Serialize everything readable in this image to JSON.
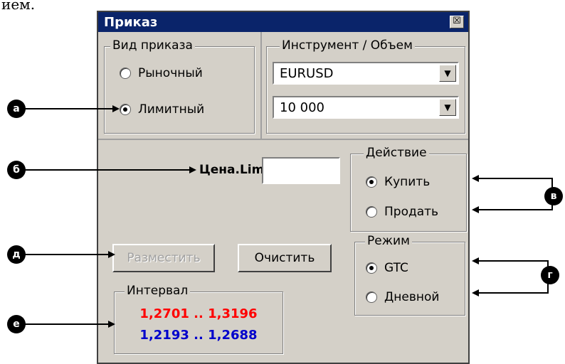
{
  "top_fragment": "ием.",
  "window": {
    "title": "Приказ",
    "close_glyph": "☒"
  },
  "order_type": {
    "legend": "Вид приказа",
    "options": [
      {
        "label": "Рыночный",
        "checked": false
      },
      {
        "label": "Лимитный",
        "checked": true
      }
    ]
  },
  "instrument": {
    "legend": "Инструмент / Объем",
    "symbol": "EURUSD",
    "volume": "10 000"
  },
  "price": {
    "label": "Цена.Lim",
    "value": ""
  },
  "action": {
    "legend": "Действие",
    "options": [
      {
        "label": "Купить",
        "checked": true
      },
      {
        "label": "Продать",
        "checked": false
      }
    ]
  },
  "buttons": {
    "place": "Разместить",
    "clear": "Очистить"
  },
  "mode": {
    "legend": "Режим",
    "options": [
      {
        "label": "GTC",
        "checked": true
      },
      {
        "label": "Дневной",
        "checked": false
      }
    ]
  },
  "interval": {
    "legend": "Интервал",
    "line1": "1,2701 .. 1,3196",
    "line2": "1,2193 .. 1,2688",
    "line1_color": "#ff0000",
    "line2_color": "#0000cc"
  },
  "annotations": {
    "a": "а",
    "b": "б",
    "v": "в",
    "g": "г",
    "d": "д",
    "e": "е"
  }
}
